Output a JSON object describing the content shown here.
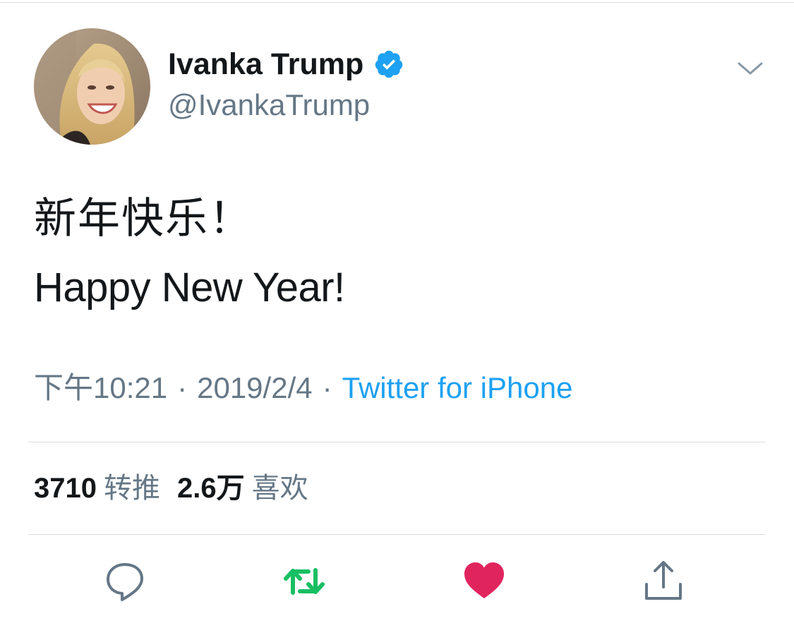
{
  "tweet": {
    "author": {
      "display_name": "Ivanka Trump",
      "handle": "@IvankaTrump",
      "verified": true,
      "verified_icon": "verified-badge-icon"
    },
    "text_lines": [
      "新年快乐！",
      "Happy New Year!"
    ],
    "time": "下午10:21",
    "separator": "·",
    "date": "2019/2/4",
    "source": "Twitter for iPhone"
  },
  "stats": {
    "retweets_count": "3710",
    "retweets_label": "转推",
    "likes_count": "2.6万",
    "likes_label": "喜欢"
  },
  "actions": {
    "reply_icon": "reply-icon",
    "retweet_icon": "retweet-icon",
    "like_icon": "heart-icon",
    "share_icon": "share-icon"
  },
  "colors": {
    "text_primary": "#14171a",
    "text_secondary": "#657786",
    "link": "#1da1f2",
    "verified": "#1da1f2",
    "retweet_active": "#17bf63",
    "like_active": "#e0245e",
    "divider": "#dcdde0"
  }
}
